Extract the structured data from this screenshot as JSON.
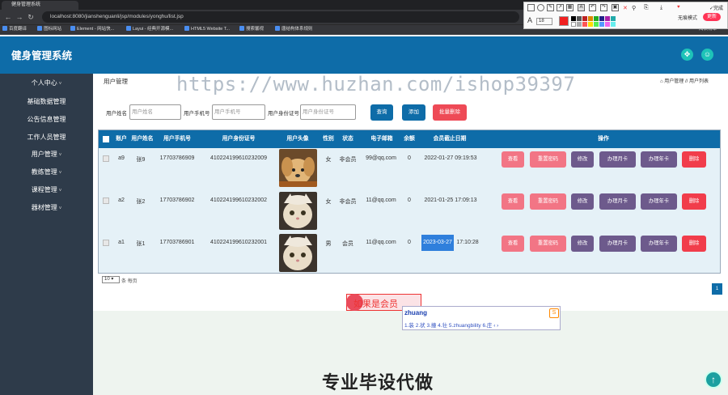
{
  "browser": {
    "tab_title": "健身管理系统",
    "url": "localhost:8080/jianshenguanli/jsp/modules/yonghu/list.jsp",
    "bookmarks": [
      "百度翻译",
      "图标网站",
      "Element - 网站快...",
      "Layui - 经典开源模...",
      "HTML5 Website T...",
      "搜索馨视",
      "唐结构体系规则"
    ],
    "reading_list": "阅读清单",
    "mode_label": "无痕模式",
    "update_label": "更新",
    "done_label": "完成",
    "font_size": "18"
  },
  "app": {
    "title": "健身管理系统",
    "header_icons": [
      "fullscreen-icon",
      "user-icon"
    ]
  },
  "sidebar": {
    "items": [
      {
        "label": "个人中心",
        "caret": true
      },
      {
        "label": "基础数据管理",
        "caret": false
      },
      {
        "label": "公告信息管理",
        "caret": false
      },
      {
        "label": "工作人员管理",
        "caret": false
      },
      {
        "label": "用户管理",
        "caret": true
      },
      {
        "label": "教练管理",
        "caret": true
      },
      {
        "label": "课程管理",
        "caret": true
      },
      {
        "label": "器材管理",
        "caret": true
      }
    ]
  },
  "page": {
    "title": "用户管理",
    "breadcrumb": "⌂ 用户管理 // 用户列表",
    "watermark": "https://www.huzhan.com/ishop39397"
  },
  "search": {
    "name_label": "用户姓名",
    "name_placeholder": "用户姓名",
    "phone_label": "用户手机号",
    "phone_placeholder": "用户手机号",
    "idcard_label": "用户身份证号",
    "idcard_placeholder": "用户身份证号",
    "search_button": "查询",
    "add_button": "添加",
    "batch_delete_button": "批量删除"
  },
  "table": {
    "headers": [
      "账户",
      "用户姓名",
      "用户手机号",
      "用户身份证号",
      "用户头像",
      "性别",
      "状态",
      "电子邮箱",
      "余额",
      "会员截止日期",
      "操作"
    ],
    "rows": [
      {
        "account": "a9",
        "name": "张9",
        "phone": "17703786909",
        "idcard": "410224199610232009",
        "gender": "女",
        "status": "非会员",
        "email": "99@qq.com",
        "balance": "0",
        "expire": "2022-01-27 09:19:53",
        "avatar": "puppy"
      },
      {
        "account": "a2",
        "name": "张2",
        "phone": "17703786902",
        "idcard": "410224199610232002",
        "gender": "女",
        "status": "非会员",
        "email": "11@qq.com",
        "balance": "0",
        "expire": "2021-01-25 17:09:13",
        "avatar": "cat"
      },
      {
        "account": "a1",
        "name": "张1",
        "phone": "17703786901",
        "idcard": "410224199610232001",
        "gender": "男",
        "status": "会员",
        "email": "11@qq.com",
        "balance": "0",
        "expire_date": "2023-03-27",
        "expire_time": "17:10:28",
        "avatar": "cat"
      }
    ],
    "actions": [
      "查看",
      "重置密码",
      "修改",
      "办理月卡",
      "办理年卡",
      "删除"
    ]
  },
  "pagination": {
    "page_size": "10",
    "page_size_label": "条 每页",
    "current_page": "1"
  },
  "overlay": {
    "member_text": "如果是会员",
    "ime_input": "zhuang",
    "ime_candidates": "1.装 2.状 3.撞 4.壮 5.zhuangbility 6.庄",
    "big_text": "专业毕设代做"
  },
  "colors": {
    "header": "#0e6ca8",
    "sidebar": "#2e3b4a",
    "pink_button": "#f27585",
    "purple_button": "#6d5a8c",
    "red_button": "#f13d4b",
    "teal_icon": "#1ec3b8"
  }
}
